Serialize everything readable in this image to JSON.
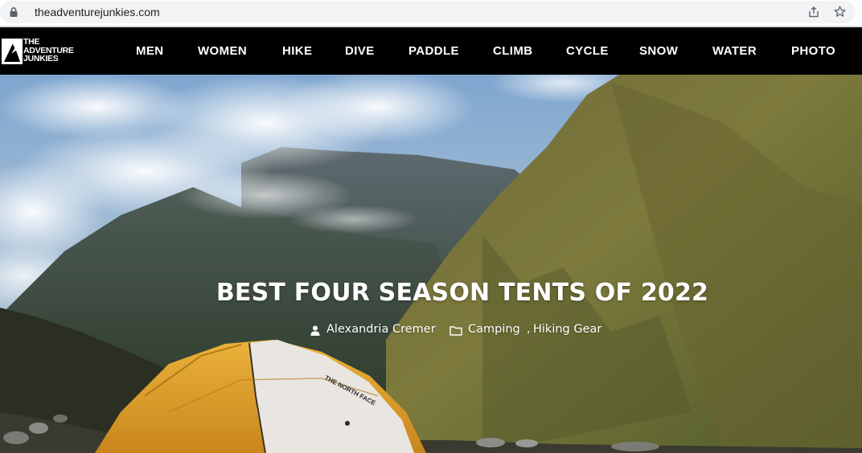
{
  "browser": {
    "url": "theadventurejunkies.com",
    "icons": [
      "lock-icon",
      "share-icon",
      "star-icon"
    ]
  },
  "site": {
    "logo": {
      "line1": "THE",
      "line2": "ADVENTURE",
      "line3": "JUNKIES"
    },
    "nav": [
      "MEN",
      "WOMEN",
      "HIKE",
      "DIVE",
      "PADDLE",
      "CLIMB",
      "CYCLE",
      "SNOW",
      "WATER",
      "PHOTO"
    ]
  },
  "hero": {
    "title": "BEST FOUR SEASON TENTS OF 2022",
    "author": "Alexandria Cremer",
    "categories": [
      "Camping",
      "Hiking Gear"
    ],
    "separator": ",",
    "icons": [
      "user-icon",
      "folder-icon"
    ],
    "tent_print": "THE NORTH FACE"
  },
  "colors": {
    "nav_bg": "#000000",
    "nav_text": "#ffffff",
    "hero_text": "#ffffff",
    "tent": "#e8a52a"
  }
}
